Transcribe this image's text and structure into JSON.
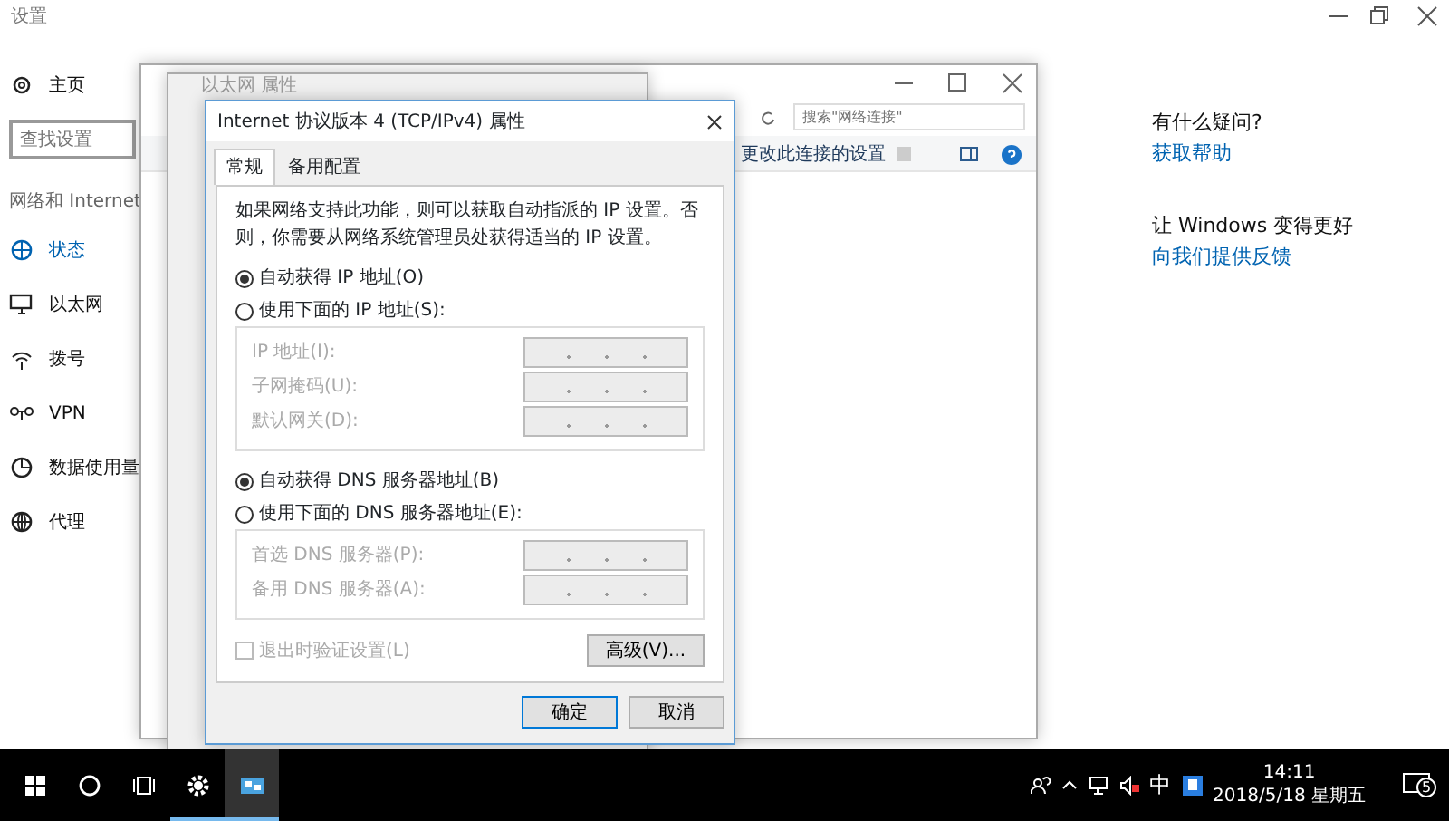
{
  "settings": {
    "title": "设置",
    "nav": {
      "home": "主页",
      "search_placeholder": "查找设置",
      "section": "网络和 Internet",
      "items": [
        {
          "kind": "status",
          "label": "状态",
          "selected": true
        },
        {
          "kind": "ethernet",
          "label": "以太网",
          "selected": false
        },
        {
          "kind": "dialup",
          "label": "拨号",
          "selected": false
        },
        {
          "kind": "vpn",
          "label": "VPN",
          "selected": false
        },
        {
          "kind": "data",
          "label": "数据使用量",
          "selected": false
        },
        {
          "kind": "proxy",
          "label": "代理",
          "selected": false
        }
      ]
    },
    "aside": [
      {
        "heading": "有什么疑问?",
        "link": "获取帮助"
      },
      {
        "heading": "让 Windows 变得更好",
        "link": "向我们提供反馈"
      }
    ]
  },
  "network_window": {
    "search_placeholder": "搜索\"网络连接\"",
    "toolbar_text": "更改此连接的设置"
  },
  "ethernet_window": {
    "title": "以太网 属性"
  },
  "dialog": {
    "title": "Internet 协议版本 4 (TCP/IPv4) 属性",
    "tabs": [
      {
        "label": "常规",
        "selected": true
      },
      {
        "label": "备用配置",
        "selected": false
      }
    ],
    "description": "如果网络支持此功能，则可以获取自动指派的 IP 设置。否则，你需要从网络系统管理员处获得适当的 IP 设置。",
    "ip_options": [
      {
        "label": "自动获得 IP 地址(O)",
        "selected": true
      },
      {
        "label": "使用下面的 IP 地址(S):",
        "selected": false
      }
    ],
    "ip_fields": [
      {
        "label": "IP 地址(I):",
        "disabled": true
      },
      {
        "label": "子网掩码(U):",
        "disabled": true
      },
      {
        "label": "默认网关(D):",
        "disabled": true
      }
    ],
    "dns_options": [
      {
        "label": "自动获得 DNS 服务器地址(B)",
        "selected": true
      },
      {
        "label": "使用下面的 DNS 服务器地址(E):",
        "selected": false
      }
    ],
    "dns_fields": [
      {
        "label": "首选 DNS 服务器(P):",
        "disabled": true
      },
      {
        "label": "备用 DNS 服务器(A):",
        "disabled": true
      }
    ],
    "validate": {
      "label": "退出时验证设置(L)",
      "checked": false,
      "disabled": true
    },
    "advanced": "高级(V)...",
    "ok": "确定",
    "cancel": "取消"
  },
  "taskbar": {
    "items": [
      {
        "kind": "start",
        "open": false,
        "selected": false
      },
      {
        "kind": "cortana",
        "open": false,
        "selected": false
      },
      {
        "kind": "taskview",
        "open": false,
        "selected": false
      },
      {
        "kind": "settings",
        "open": true,
        "selected": false
      },
      {
        "kind": "network",
        "open": true,
        "selected": true
      }
    ],
    "ime": "中",
    "time": "14:11",
    "date": "2018/5/18 星期五",
    "notifications": "5"
  }
}
